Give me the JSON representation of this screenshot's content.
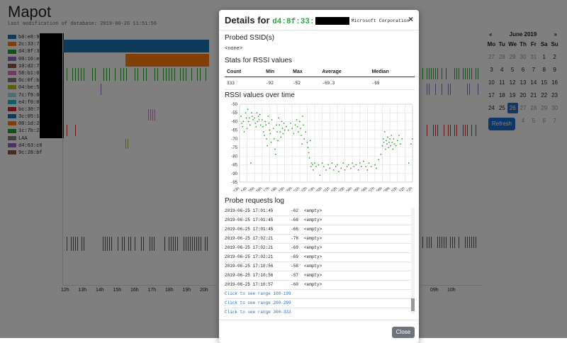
{
  "app": {
    "title": "Mapot",
    "subtitle": "Last modification of database: 2019-06-26 11:51:56"
  },
  "legend": [
    {
      "label": "b0:e8:92",
      "color": "#1f77b4"
    },
    {
      "label": "2c:33:7a",
      "color": "#ff7f0e"
    },
    {
      "label": "d4:8f:33",
      "color": "#2ca02c"
    },
    {
      "label": "00:16:eb",
      "color": "#9467bd"
    },
    {
      "label": "10:d2:76",
      "color": "#8c564b"
    },
    {
      "label": "58:b1:0f",
      "color": "#e377c2"
    },
    {
      "label": "6c:0f:b5",
      "color": "#7f7f7f"
    },
    {
      "label": "04:be:52",
      "color": "#bcbd22"
    },
    {
      "label": "7c:f9:0e",
      "color": "#9edae5"
    },
    {
      "label": "e4:f0:07",
      "color": "#17becf"
    },
    {
      "label": "bc:30:7d",
      "color": "#d62728"
    },
    {
      "label": "3c:05:18",
      "color": "#1f77b4"
    },
    {
      "label": "00:1d:29",
      "color": "#ff7f0e"
    },
    {
      "label": "1c:7b:23",
      "color": "#2ca02c"
    },
    {
      "label": "LAA",
      "color": "#7f7f7f"
    },
    {
      "label": "d4:63:c6",
      "color": "#9467bd"
    },
    {
      "label": "9c:28:bf",
      "color": "#8c564b"
    }
  ],
  "timeline": {
    "hour_labels": [
      "12h",
      "13h",
      "14h",
      "15h",
      "16h",
      "17h",
      "18h",
      "19h",
      "20h"
    ],
    "right_hour_labels": [
      "09h",
      "10h"
    ]
  },
  "calendar": {
    "month": "June 2019",
    "prev": "«",
    "next": "»",
    "weekdays": [
      "Mo",
      "Tu",
      "We",
      "Th",
      "Fr",
      "Sa",
      "Su"
    ],
    "days": [
      {
        "d": "27",
        "dim": true
      },
      {
        "d": "28",
        "dim": true
      },
      {
        "d": "29",
        "dim": true
      },
      {
        "d": "30",
        "dim": true
      },
      {
        "d": "31",
        "dim": true
      },
      {
        "d": "1",
        "dim": false
      },
      {
        "d": "2",
        "dim": false
      },
      {
        "d": "3",
        "dim": false
      },
      {
        "d": "4",
        "dim": false
      },
      {
        "d": "5",
        "dim": false
      },
      {
        "d": "6",
        "dim": false
      },
      {
        "d": "7",
        "dim": false
      },
      {
        "d": "8",
        "dim": false
      },
      {
        "d": "9",
        "dim": false
      },
      {
        "d": "10",
        "dim": false
      },
      {
        "d": "11",
        "dim": false
      },
      {
        "d": "12",
        "dim": false
      },
      {
        "d": "13",
        "dim": false
      },
      {
        "d": "14",
        "dim": false
      },
      {
        "d": "15",
        "dim": false
      },
      {
        "d": "16",
        "dim": false
      },
      {
        "d": "17",
        "dim": false
      },
      {
        "d": "18",
        "dim": false
      },
      {
        "d": "19",
        "dim": false
      },
      {
        "d": "20",
        "dim": false
      },
      {
        "d": "21",
        "dim": false
      },
      {
        "d": "22",
        "dim": false
      },
      {
        "d": "23",
        "dim": false
      },
      {
        "d": "24",
        "dim": false
      },
      {
        "d": "25",
        "dim": false
      },
      {
        "d": "26",
        "dim": false,
        "sel": true
      },
      {
        "d": "27",
        "dim": true
      },
      {
        "d": "28",
        "dim": true
      },
      {
        "d": "29",
        "dim": true
      },
      {
        "d": "30",
        "dim": true
      },
      {
        "d": "1",
        "dim": true
      },
      {
        "d": "2",
        "dim": true
      },
      {
        "d": "3",
        "dim": true
      },
      {
        "d": "4",
        "dim": true
      },
      {
        "d": "5",
        "dim": true
      },
      {
        "d": "6",
        "dim": true
      },
      {
        "d": "7",
        "dim": true
      }
    ],
    "refresh_label": "Refresh"
  },
  "modal": {
    "title_prefix": "Details for",
    "mac_visible": "d4:8f:33:",
    "vendor": "Microsoft Corporation",
    "close_x": "×",
    "probed_heading": "Probed SSID(s)",
    "probed_value": "<none>",
    "stats_heading": "Stats for RSSI values",
    "stats_headers": [
      "Count",
      "Min",
      "Max",
      "Average",
      "Median"
    ],
    "stats_values": [
      "333",
      "-92",
      "-52",
      "-69.3",
      "-69"
    ],
    "rssi_heading": "RSSI values over time",
    "log_heading": "Probe requests log",
    "log_rows": [
      {
        "time": "2019-06-25 17:01:45",
        "rssi": "-62",
        "ssid": "<empty>"
      },
      {
        "time": "2019-06-25 17:01:45",
        "rssi": "-66",
        "ssid": "<empty>"
      },
      {
        "time": "2019-06-25 17:01:45",
        "rssi": "-66",
        "ssid": "<empty>"
      },
      {
        "time": "2019-06-25 17:02:21",
        "rssi": "-78",
        "ssid": "<empty>"
      },
      {
        "time": "2019-06-25 17:02:21",
        "rssi": "-69",
        "ssid": "<empty>"
      },
      {
        "time": "2019-06-25 17:02:21",
        "rssi": "-69",
        "ssid": "<empty>"
      },
      {
        "time": "2019-06-25 17:10:56",
        "rssi": "-58",
        "ssid": "<empty>"
      },
      {
        "time": "2019-06-25 17:10:56",
        "rssi": "-57",
        "ssid": "<empty>"
      },
      {
        "time": "2019-06-25 17:10:57",
        "rssi": "-60",
        "ssid": "<empty>"
      }
    ],
    "log_links": [
      "Click to see range 100-199",
      "Click to see range 200-299",
      "Click to see range 300-333"
    ],
    "close_button": "Close"
  },
  "chart_data": {
    "type": "scatter",
    "title": "",
    "xlabel": "",
    "ylabel": "",
    "ylim": [
      -95,
      -50
    ],
    "y_ticks": [
      -50,
      -55,
      -60,
      -65,
      -70,
      -75,
      -80,
      -85,
      -90,
      -95
    ],
    "x_tick_labels": [
      "13h",
      "14h",
      "15h",
      "16h",
      "17h",
      "18h",
      "19h",
      "20h",
      "21h",
      "22h",
      "23h",
      "00h",
      "01h",
      "02h",
      "03h",
      "04h",
      "05h",
      "06h",
      "07h",
      "08h",
      "09h",
      "10h",
      "11h",
      "12h"
    ],
    "series_color": "#2ca02c",
    "points": [
      [
        0.2,
        -57
      ],
      [
        0.3,
        -61
      ],
      [
        0.4,
        -63
      ],
      [
        0.5,
        -60
      ],
      [
        0.6,
        -66
      ],
      [
        0.8,
        -55
      ],
      [
        0.9,
        -58
      ],
      [
        1.0,
        -64
      ],
      [
        1.1,
        -53
      ],
      [
        1.2,
        -60
      ],
      [
        1.3,
        -58
      ],
      [
        1.4,
        -62
      ],
      [
        1.5,
        -84
      ],
      [
        1.6,
        -55
      ],
      [
        1.7,
        -57
      ],
      [
        1.8,
        -59
      ],
      [
        2.0,
        -58
      ],
      [
        2.1,
        -61
      ],
      [
        2.2,
        -63
      ],
      [
        2.3,
        -55
      ],
      [
        2.4,
        -60
      ],
      [
        2.5,
        -57
      ],
      [
        2.6,
        -59
      ],
      [
        2.7,
        -56
      ],
      [
        2.8,
        -62
      ],
      [
        3.0,
        -59
      ],
      [
        3.1,
        -63
      ],
      [
        3.2,
        -66
      ],
      [
        3.3,
        -68
      ],
      [
        3.4,
        -60
      ],
      [
        3.5,
        -62
      ],
      [
        3.6,
        -70
      ],
      [
        3.7,
        -74
      ],
      [
        3.8,
        -57
      ],
      [
        3.9,
        -61
      ],
      [
        4.0,
        -65
      ],
      [
        4.1,
        -67
      ],
      [
        4.2,
        -72
      ],
      [
        4.3,
        -59
      ],
      [
        4.5,
        -64
      ],
      [
        4.6,
        -70
      ],
      [
        4.7,
        -76
      ],
      [
        4.8,
        -79
      ],
      [
        4.9,
        -62
      ],
      [
        5.0,
        -66
      ],
      [
        5.1,
        -71
      ],
      [
        5.2,
        -58
      ],
      [
        5.3,
        -62
      ],
      [
        5.4,
        -66
      ],
      [
        5.5,
        -69
      ],
      [
        5.6,
        -60
      ],
      [
        5.7,
        -64
      ],
      [
        5.8,
        -67
      ],
      [
        5.9,
        -61
      ],
      [
        6.0,
        -65
      ],
      [
        6.2,
        -63
      ],
      [
        6.5,
        -65
      ],
      [
        6.8,
        -61
      ],
      [
        7.0,
        -64
      ],
      [
        7.2,
        -67
      ],
      [
        7.4,
        -62
      ],
      [
        7.6,
        -59
      ],
      [
        7.7,
        -63
      ],
      [
        7.8,
        -66
      ],
      [
        8.0,
        -60
      ],
      [
        8.1,
        -64
      ],
      [
        8.2,
        -68
      ],
      [
        8.3,
        -73
      ],
      [
        8.4,
        -57
      ],
      [
        8.5,
        -62
      ],
      [
        8.6,
        -70
      ],
      [
        8.8,
        -66
      ],
      [
        9.0,
        -72
      ],
      [
        9.1,
        -75
      ],
      [
        9.2,
        -78
      ],
      [
        9.3,
        -81
      ],
      [
        9.4,
        -71
      ],
      [
        9.5,
        -86
      ],
      [
        9.6,
        -84
      ],
      [
        9.7,
        -85
      ],
      [
        9.8,
        -88
      ],
      [
        10.0,
        -84
      ],
      [
        10.2,
        -86
      ],
      [
        10.5,
        -85
      ],
      [
        10.7,
        -91
      ],
      [
        11.0,
        -84
      ],
      [
        11.2,
        -86
      ],
      [
        11.5,
        -88
      ],
      [
        11.8,
        -85
      ],
      [
        12.0,
        -87
      ],
      [
        12.3,
        -84
      ],
      [
        12.5,
        -88
      ],
      [
        12.8,
        -86
      ],
      [
        13.0,
        -85
      ],
      [
        13.2,
        -89
      ],
      [
        13.5,
        -87
      ],
      [
        13.8,
        -84
      ],
      [
        14.0,
        -88
      ],
      [
        14.3,
        -86
      ],
      [
        14.5,
        -85
      ],
      [
        14.8,
        -87
      ],
      [
        15.0,
        -84
      ],
      [
        15.2,
        -86
      ],
      [
        15.5,
        -85
      ],
      [
        15.8,
        -88
      ],
      [
        16.0,
        -84
      ],
      [
        16.2,
        -86
      ],
      [
        16.5,
        -83
      ],
      [
        16.8,
        -86
      ],
      [
        17.0,
        -88
      ],
      [
        17.2,
        -84
      ],
      [
        17.5,
        -86
      ],
      [
        18.0,
        -85
      ],
      [
        18.2,
        -87
      ],
      [
        18.5,
        -82
      ],
      [
        18.8,
        -79
      ],
      [
        19.0,
        -74
      ],
      [
        19.1,
        -70
      ],
      [
        19.2,
        -72
      ],
      [
        19.3,
        -66
      ],
      [
        19.4,
        -76
      ],
      [
        19.5,
        -71
      ],
      [
        19.6,
        -73
      ],
      [
        19.7,
        -69
      ],
      [
        19.8,
        -75
      ],
      [
        19.9,
        -72
      ],
      [
        20.0,
        -70
      ],
      [
        20.1,
        -74
      ],
      [
        20.2,
        -68
      ],
      [
        20.3,
        -72
      ],
      [
        20.4,
        -76
      ],
      [
        20.5,
        -70
      ],
      [
        20.6,
        -73
      ],
      [
        20.8,
        -74
      ],
      [
        21.0,
        -71
      ],
      [
        21.2,
        -68
      ],
      [
        21.4,
        -73
      ],
      [
        21.6,
        -70
      ],
      [
        22.5,
        -84
      ],
      [
        22.8,
        -73
      ],
      [
        23.0,
        -70
      ]
    ]
  }
}
